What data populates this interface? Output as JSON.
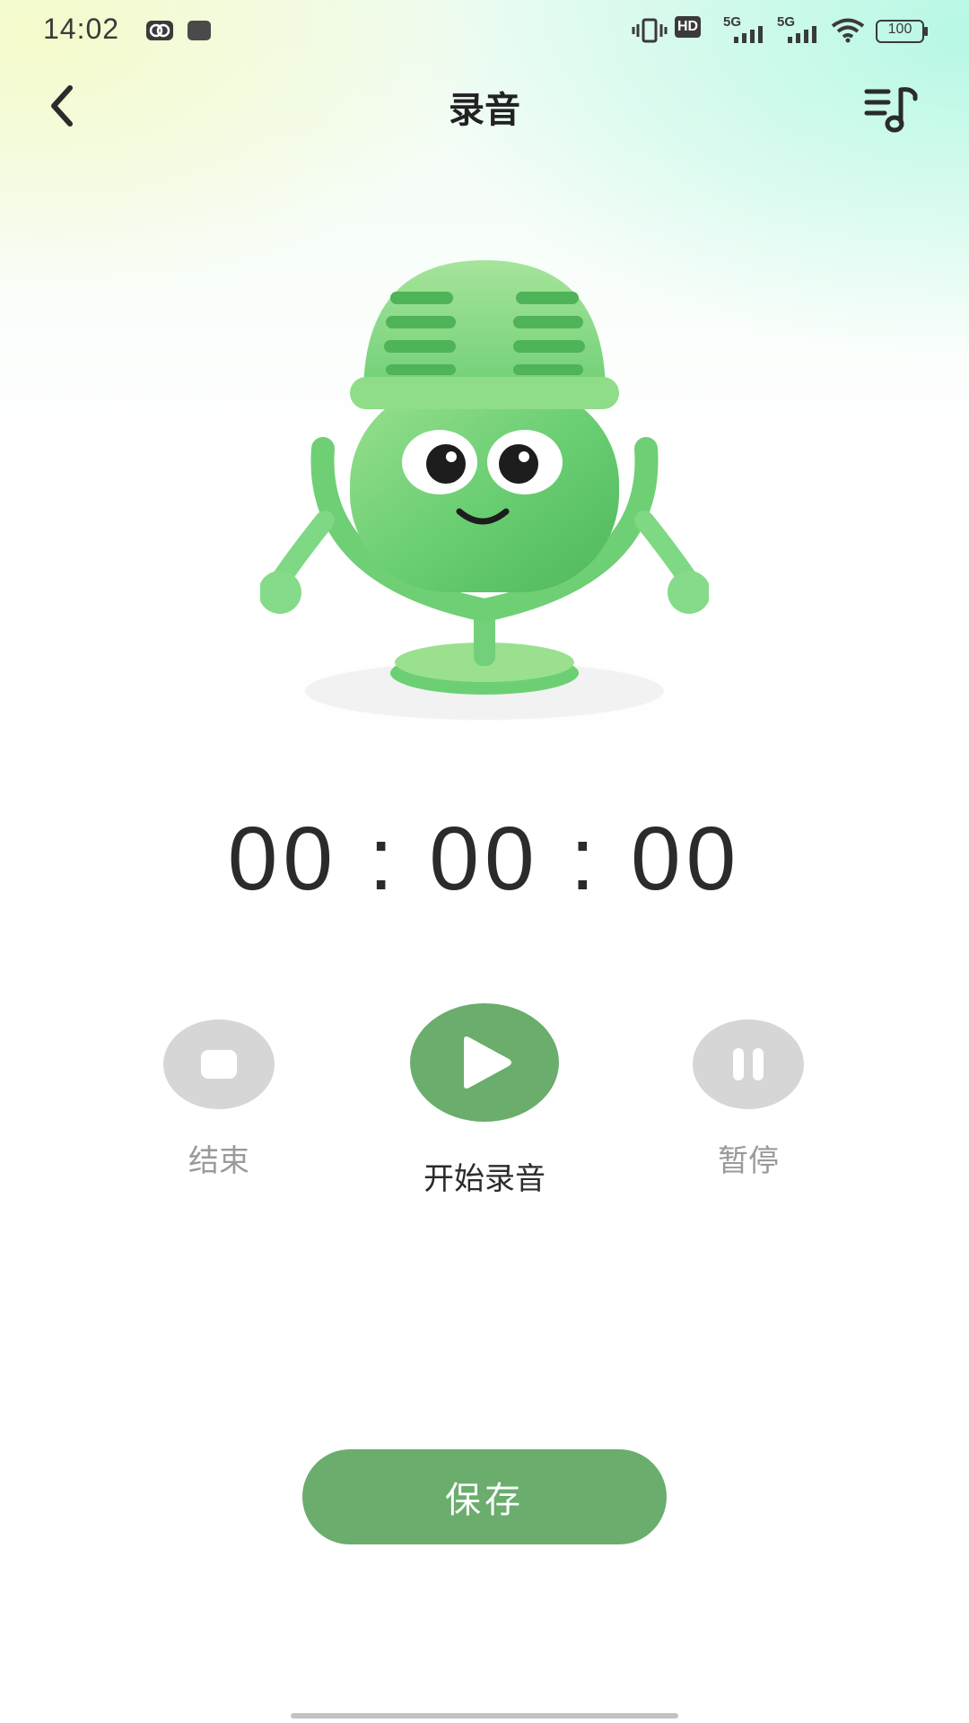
{
  "status_bar": {
    "time": "14:02",
    "battery": "100",
    "network_1": "5G",
    "network_2": "5G",
    "hd_label": "HD",
    "icons": [
      "vibrate-icon",
      "hd-voice-icon",
      "signal-5g-icon",
      "signal-5g-icon",
      "wifi-icon",
      "battery-icon"
    ]
  },
  "header": {
    "title": "录音",
    "back_icon": "chevron-left-icon",
    "right_icon": "playlist-music-icon"
  },
  "mascot": {
    "icon": "microphone-mascot-illustration"
  },
  "timer": {
    "value": "00 : 00 : 00"
  },
  "controls": {
    "stop_label": "结束",
    "record_label": "开始录音",
    "pause_label": "暂停"
  },
  "save": {
    "label": "保存"
  },
  "colors": {
    "accent": "#6aad6c",
    "disabled": "#d6d6d6",
    "text_primary": "#2b2b2b",
    "text_disabled": "#9a9a9a"
  }
}
